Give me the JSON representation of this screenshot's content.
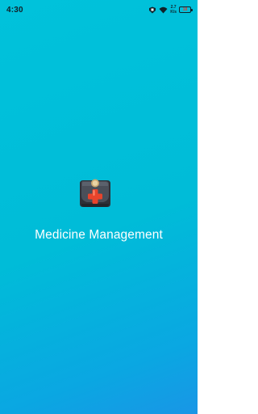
{
  "status_bar": {
    "time": "4:30",
    "network_speed_value": "2.7",
    "network_speed_unit": "K/s",
    "battery_level": "18",
    "icons": [
      "notification-icon",
      "wifi-icon",
      "battery-icon"
    ]
  },
  "splash": {
    "app_title": "Medicine Management",
    "logo_icon": "first-aid-kit-icon"
  },
  "colors": {
    "background_top": "#00c2db",
    "background_bottom": "#1996e6",
    "title_text": "#ffffff",
    "kit_red": "#e8442c"
  }
}
